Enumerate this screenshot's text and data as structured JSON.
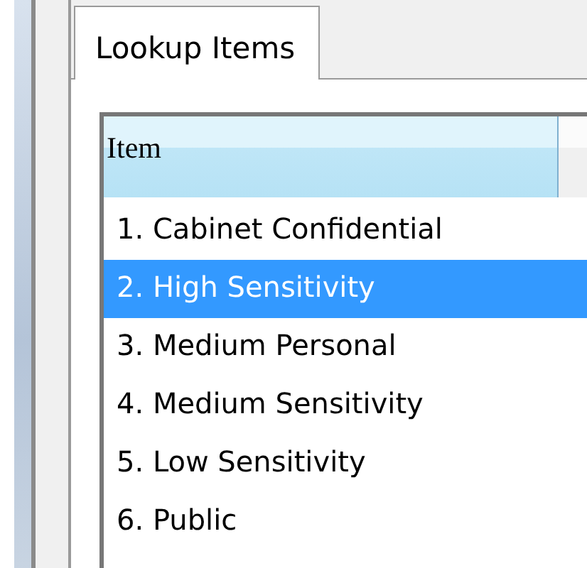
{
  "tabs": [
    {
      "label": "Lookup Items",
      "selected": true
    }
  ],
  "list": {
    "columns": [
      "Item"
    ],
    "rows": [
      {
        "label": "1. Cabinet Confidential",
        "selected": false
      },
      {
        "label": "2. High Sensitivity",
        "selected": true
      },
      {
        "label": "3. Medium Personal",
        "selected": false
      },
      {
        "label": "4. Medium Sensitivity",
        "selected": false
      },
      {
        "label": "5. Low Sensitivity",
        "selected": false
      },
      {
        "label": "6. Public",
        "selected": false
      }
    ]
  }
}
